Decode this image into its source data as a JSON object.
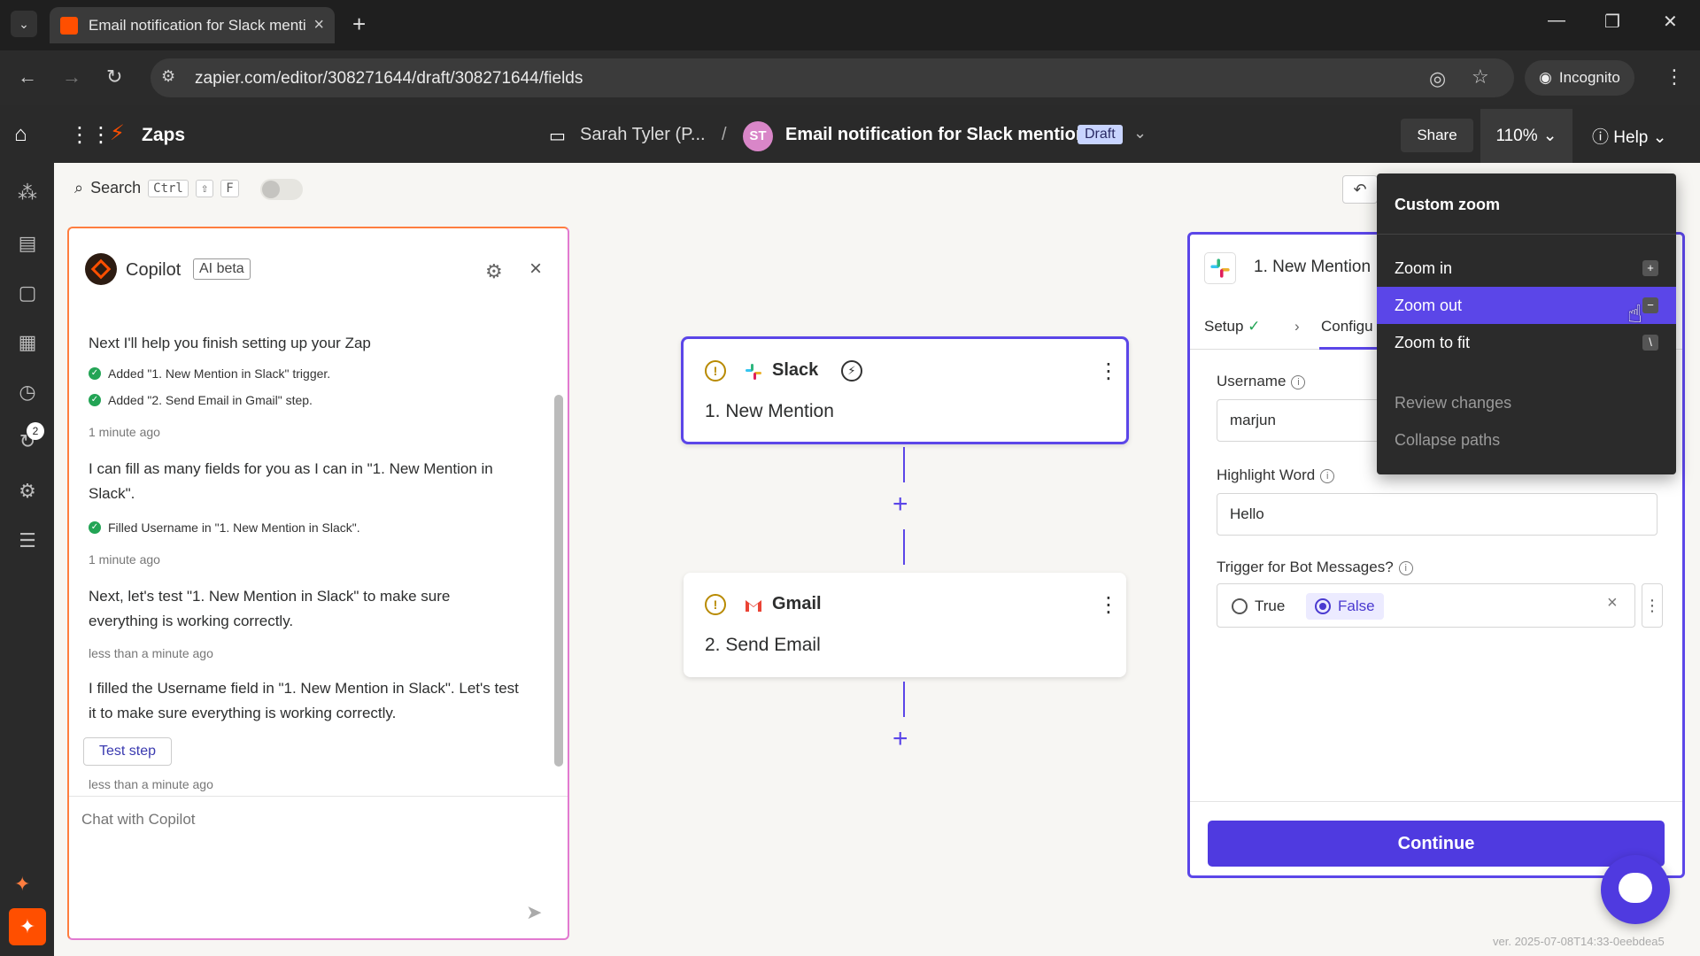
{
  "browser": {
    "tab_title": "Email notification for Slack mentions",
    "url": "zapier.com/editor/308271644/draft/308271644/fields",
    "incognito_label": "Incognito"
  },
  "header": {
    "app_name": "Zaps",
    "folder": "Sarah Tyler (P...",
    "separator": "/",
    "avatar_initials": "ST",
    "zap_title": "Email notification for Slack mentions",
    "status": "Draft",
    "share_label": "Share",
    "zoom_level": "110%",
    "help_label": "Help"
  },
  "toolbar": {
    "search_label": "Search",
    "shortcut_ctrl": "Ctrl",
    "shortcut_shift": "⇧",
    "shortcut_f": "F"
  },
  "rail": {
    "badge_count": "2"
  },
  "copilot": {
    "title": "Copilot",
    "badge": "AI beta",
    "messages": [
      {
        "text": "Next I'll help you finish setting up your Zap"
      },
      {
        "text": "Added \"1. New Mention in Slack\" trigger."
      },
      {
        "text": "Added \"2. Send Email in Gmail\" step."
      },
      {
        "text": "1 minute ago"
      },
      {
        "text": "I can fill as many fields for you as I can in \"1. New Mention in Slack\"."
      },
      {
        "text": "Filled Username in \"1. New Mention in Slack\"."
      },
      {
        "text": "1 minute ago"
      },
      {
        "text": "Next, let's test \"1. New Mention in Slack\" to make sure everything is working correctly."
      },
      {
        "text": "less than a minute ago"
      },
      {
        "text": "I filled the Username field in \"1. New Mention in Slack\". Let's test it to make sure everything is working correctly."
      },
      {
        "text": "less than a minute ago"
      }
    ],
    "test_step_label": "Test step",
    "chat_placeholder": "Chat with Copilot"
  },
  "nodes": [
    {
      "app": "Slack",
      "step": "1. New Mention"
    },
    {
      "app": "Gmail",
      "step": "2. Send Email"
    }
  ],
  "panel": {
    "title": "1. New Mention",
    "tab_setup": "Setup",
    "tab_configure": "Configu",
    "username_label": "Username",
    "username_value": "marjun",
    "highlight_label": "Highlight Word",
    "highlight_value": "Hello",
    "bot_label": "Trigger for Bot Messages?",
    "option_true": "True",
    "option_false": "False",
    "continue_label": "Continue"
  },
  "zoom_menu": {
    "custom": "Custom zoom",
    "zoom_in": "Zoom in",
    "zoom_in_key": "+",
    "zoom_out": "Zoom out",
    "zoom_out_key": "−",
    "zoom_fit": "Zoom to fit",
    "zoom_fit_key": "\\",
    "review": "Review changes",
    "collapse": "Collapse paths"
  },
  "version": "ver. 2025-07-08T14:33-0eebdea5",
  "colors": {
    "accent": "#5b46e8",
    "brand": "#ff4f00",
    "success": "#23a455"
  }
}
